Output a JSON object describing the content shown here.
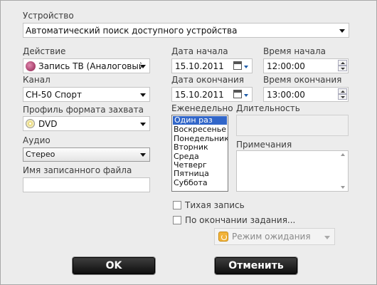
{
  "device": {
    "label": "Устройство",
    "value": "Автоматический поиск доступного устройства"
  },
  "action": {
    "label": "Действие",
    "value": "Запись ТВ (Аналоговый"
  },
  "channel": {
    "label": "Канал",
    "value": "CH-50 Спорт"
  },
  "profile": {
    "label": "Профиль формата захвата",
    "value": "DVD"
  },
  "audio": {
    "label": "Аудио",
    "value": "Стерео"
  },
  "filename": {
    "label": "Имя записанного файла",
    "value": ""
  },
  "start_date": {
    "label": "Дата начала",
    "value": "15.10.2011"
  },
  "start_time": {
    "label": "Время начала",
    "value": "12:00:00"
  },
  "end_date": {
    "label": "Дата окончания",
    "value": "15.10.2011"
  },
  "end_time": {
    "label": "Время окончания",
    "value": "13:00:00"
  },
  "weekly": {
    "label": "Еженедельно",
    "items": [
      "Один раз",
      "Воскресенье",
      "Понедельник",
      "Вторник",
      "Среда",
      "Четверг",
      "Пятница",
      "Суббота"
    ],
    "selected": 0
  },
  "duration": {
    "label": "Длительность",
    "value": ""
  },
  "notes": {
    "label": "Примечания",
    "value": ""
  },
  "silent": {
    "label": "Тихая запись",
    "checked": false
  },
  "on_finish": {
    "label": "По окончании задания...",
    "checked": false
  },
  "standby": {
    "value": "Режим ожидания"
  },
  "buttons": {
    "ok": "OK",
    "cancel": "Отменить"
  }
}
